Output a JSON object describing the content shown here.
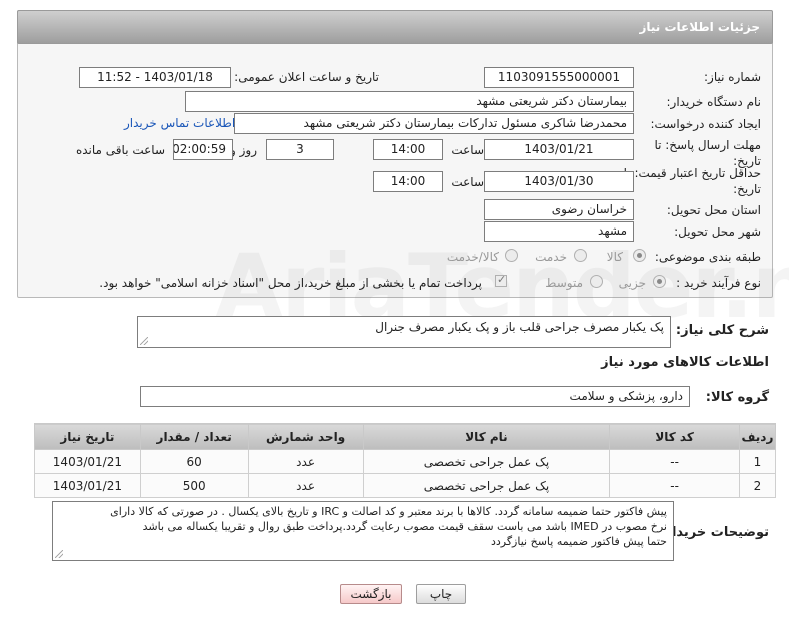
{
  "header": {
    "title": "جزئیات اطلاعات نیاز"
  },
  "fields": {
    "need_number_label": "شماره نیاز:",
    "need_number": "1103091555000001",
    "announce_label": "تاریخ و ساعت اعلان عمومی:",
    "announce_value": "1403/01/18 - 11:52",
    "buyer_org_label": "نام دستگاه خریدار:",
    "buyer_org": "بیمارستان دکتر شریعتی مشهد",
    "creator_label": "ایجاد کننده درخواست:",
    "creator": "محمدرضا شاکری مسئول تدارکات بیمارستان دکتر شریعتی مشهد",
    "contact_link": "اطلاعات تماس خریدار",
    "reply_deadline_label": "مهلت ارسال پاسخ: تا تاریخ:",
    "reply_date": "1403/01/21",
    "time_label": "ساعت",
    "reply_time": "14:00",
    "days_value": "3",
    "days_label": "روز و",
    "remaining_time": "02:00:59",
    "remaining_label": "ساعت باقی مانده",
    "price_validity_label": "حداقل تاریخ اعتبار قیمت: تا تاریخ:",
    "price_date": "1403/01/30",
    "price_time_label": "ساعت",
    "price_time": "14:00",
    "province_label": "استان محل تحویل:",
    "province": "خراسان رضوی",
    "city_label": "شهر محل تحویل:",
    "city": "مشهد",
    "category_label": "طبقه بندی موضوعی:",
    "category_options": [
      "کالا",
      "خدمت",
      "کالا/خدمت"
    ],
    "purchase_type_label": "نوع فرآیند خرید :",
    "purchase_options": [
      "جزیی",
      "متوسط"
    ],
    "payment_note": "پرداخت تمام یا بخشی از مبلغ خرید،از محل \"اسناد خزانه اسلامی\" خواهد بود."
  },
  "description": {
    "label": "شرح کلی نیاز:",
    "text": "پک یکبار مصرف جراحی قلب باز و پک یکبار مصرف جنرال"
  },
  "goods_section": {
    "title": "اطلاعات کالاهای مورد نیاز",
    "group_label": "گروه کالا:",
    "group_value": "دارو، پزشکی و سلامت"
  },
  "table": {
    "headers": [
      "ردیف",
      "کد کالا",
      "نام کالا",
      "واحد شمارش",
      "تعداد / مقدار",
      "تاریخ نیاز"
    ],
    "rows": [
      [
        "1",
        "--",
        "پک عمل جراحی تخصصی",
        "عدد",
        "60",
        "1403/01/21"
      ],
      [
        "2",
        "--",
        "پک عمل جراحی تخصصی",
        "عدد",
        "500",
        "1403/01/21"
      ]
    ]
  },
  "buyer_notes": {
    "label": "توضیحات خریدار:",
    "line1": "پیش فاکتور حتما ضمیمه سامانه گردد. کالاها با برند معتبر و کد اصالت و IRC و تاریخ بالای یکسال . در صورتی که کالا دارای",
    "line2": "نرخ مصوب در  IMED باشد می باست سقف قیمت مصوب رعایت گردد.پرداخت طبق روال و تقریبا یکساله می باشد",
    "line3": "حتما پیش فاکتور ضمیمه پاسخ نیازگردد"
  },
  "buttons": {
    "print": "چاپ",
    "back": "بازگشت"
  },
  "watermark": "AriaTender.net"
}
